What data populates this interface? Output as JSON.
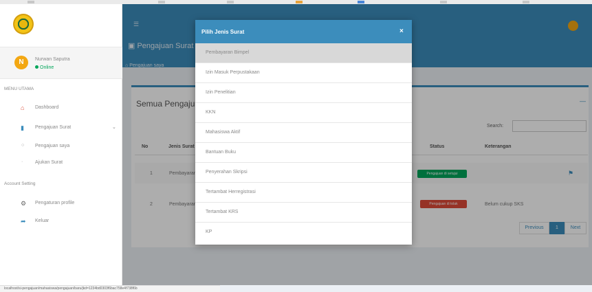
{
  "sidebar": {
    "user": {
      "initial": "N",
      "name": "Nurwan Saputra",
      "status": "Online"
    },
    "menu_header_main": "MENU UTAMA",
    "menu_header_account": "Account Setting",
    "items": [
      {
        "label": "Dashboard",
        "icon": "home-icon"
      },
      {
        "label": "Pengajuan Surat",
        "icon": "document-icon"
      },
      {
        "label": "Pengajuan saya",
        "icon": "circle-icon"
      },
      {
        "label": "Ajukan Surat",
        "icon": "dot-icon"
      },
      {
        "label": "Pengaturan profile",
        "icon": "gear-icon"
      },
      {
        "label": "Keluar",
        "icon": "share-arrow-icon"
      }
    ]
  },
  "header": {
    "page_title": "Pengajuan Surat",
    "breadcrumb": "Pengajuan saya"
  },
  "main": {
    "box_title": "Semua Pengajuan",
    "search_label": "Search:",
    "columns": [
      "No",
      "Jenis Surat",
      "Status",
      "Keterangan"
    ],
    "rows": [
      {
        "no": "1",
        "jenis": "Pembayaran",
        "status": "Pengajuan di setujui",
        "status_color": "#00a65a",
        "keterangan": ""
      },
      {
        "no": "2",
        "jenis": "Pembayaran",
        "status": "Pengajuan di tolak",
        "status_color": "#dd4b39",
        "keterangan": "Belum cukup SKS"
      }
    ],
    "pager": {
      "prev": "Previous",
      "page": "1",
      "next": "Next"
    }
  },
  "modal": {
    "title": "Pilih Jenis Surat",
    "close": "×",
    "options": [
      "Pembayaran Bimpel",
      "Izin Masuk Perpustakaan",
      "Izin Penelitian",
      "KKN",
      "Mahasiswa Aktif",
      "Bantuan Buku",
      "Penyerahan Skripsi",
      "Tertambat Herregistrasi",
      "Tertambat KRS",
      "KP"
    ]
  },
  "status_url": "localhost/si-pengajuan/mahasiswa/pengajuan/baru/jkd=1234bd0303f6bac758e4f738f6b",
  "colors": {
    "primary": "#3c8dbc",
    "success": "#00a65a",
    "danger": "#dd4b39",
    "avatar": "#f3a712"
  }
}
